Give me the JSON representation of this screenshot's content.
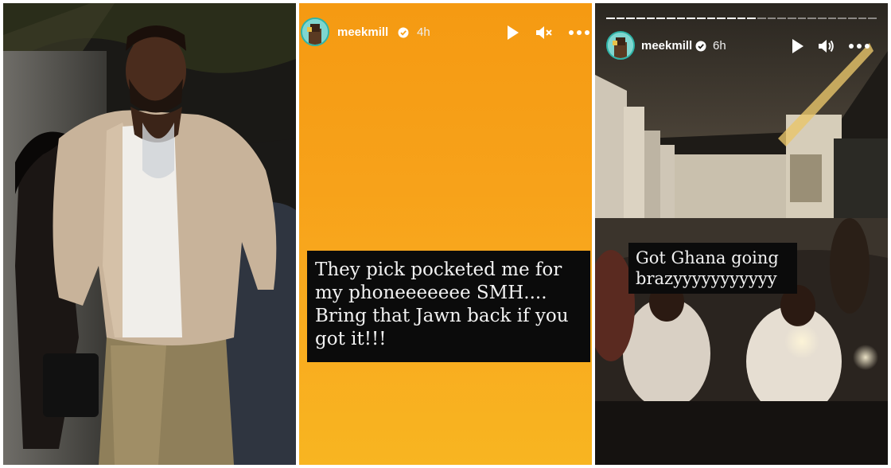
{
  "stories": [
    {
      "username": "meekmill",
      "time": "4h",
      "caption": [
        "They pick pocketed me for",
        "my phoneeeeeee SMH....",
        "Bring that Jawn back if you",
        "got it!!!"
      ]
    },
    {
      "username": "meekmill",
      "time": "6h",
      "caption": [
        "Got Ghana going",
        "brazyyyyyyyyyyy"
      ]
    }
  ],
  "colors": {
    "story_orange": "#f7a21a",
    "caption_bg": "#0b0b0b",
    "avatar_teal": "#7fd6cf"
  },
  "icons": [
    "play-icon",
    "mute-icon",
    "volume-icon",
    "more-icon",
    "verified-icon"
  ]
}
